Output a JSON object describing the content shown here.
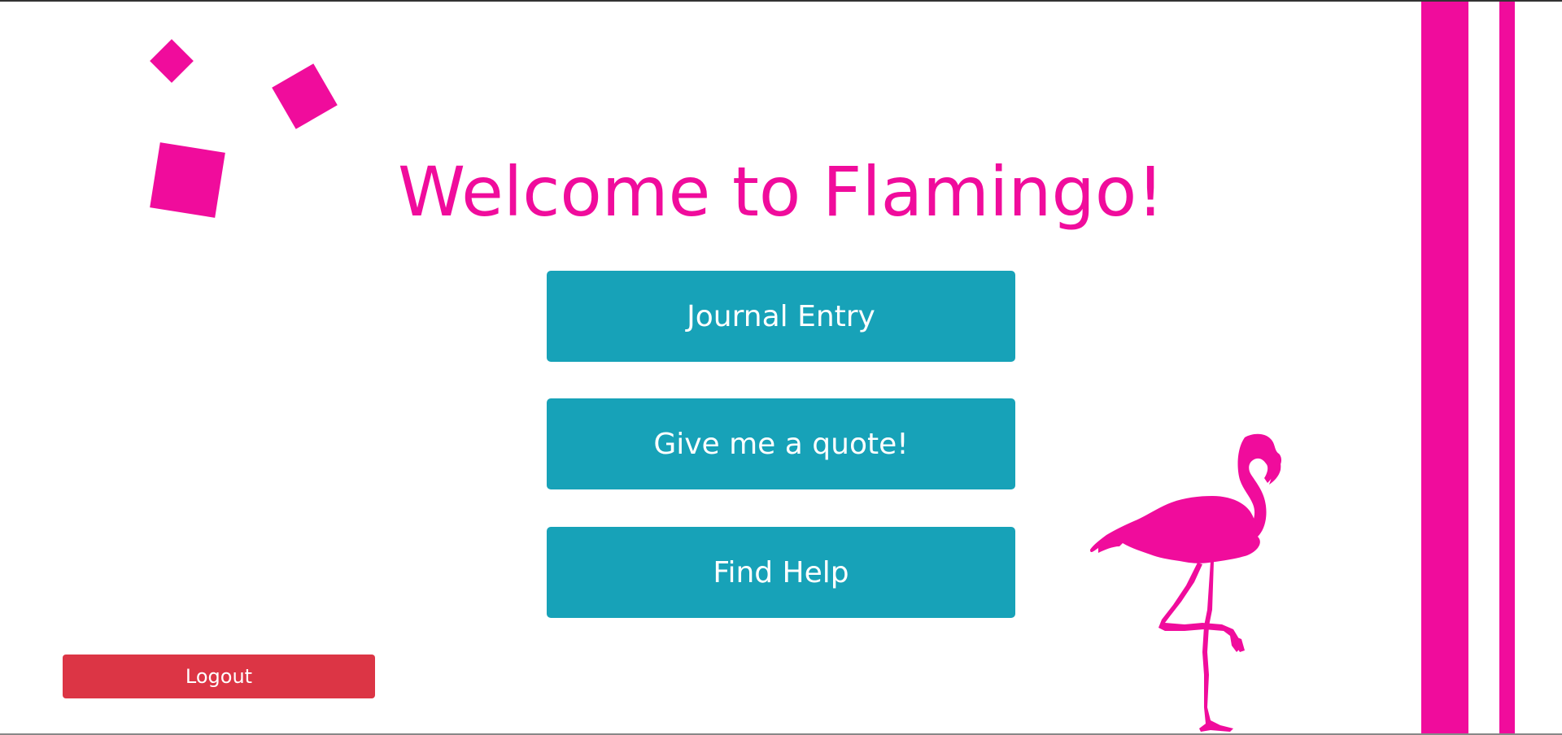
{
  "page": {
    "title": "Welcome to Flamingo!"
  },
  "menu": {
    "journal_label": "Journal Entry",
    "quote_label": "Give me a quote!",
    "help_label": "Find Help"
  },
  "account": {
    "logout_label": "Logout"
  },
  "colors": {
    "brand_pink": "#f00c9c",
    "button_teal": "#17a2b8",
    "logout_red": "#dc3545",
    "background": "#ffffff"
  },
  "icons": {
    "mascot": "flamingo-icon"
  }
}
